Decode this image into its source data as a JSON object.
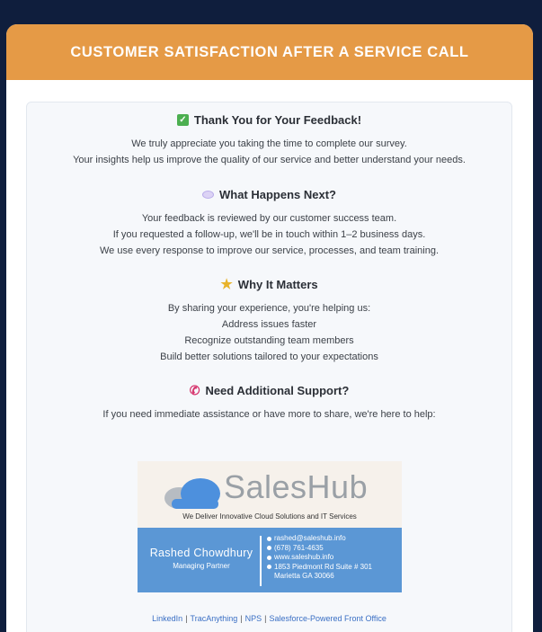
{
  "header": {
    "title": "CUSTOMER SATISFACTION AFTER A SERVICE CALL"
  },
  "sections": [
    {
      "icon": "check-icon",
      "title": "Thank You for Your Feedback!",
      "lines": [
        "We truly appreciate you taking the time to complete our survey.",
        "Your insights help us improve the quality of our service and better understand your needs."
      ]
    },
    {
      "icon": "speech-bubble-icon",
      "title": "What Happens Next?",
      "lines": [
        "Your feedback is reviewed by our customer success team.",
        "If you requested a follow-up, we'll be in touch within 1–2 business days.",
        "We use every response to improve our service, processes, and team training."
      ]
    },
    {
      "icon": "star-icon",
      "title": "Why It Matters",
      "lines": [
        "By sharing your experience, you're helping us:",
        "Address issues faster",
        "Recognize outstanding team members",
        "Build better solutions tailored to your expectations"
      ]
    },
    {
      "icon": "phone-icon",
      "title": "Need Additional Support?",
      "lines": [
        "If you need immediate assistance or have more to share, we're here to help:"
      ]
    }
  ],
  "signature": {
    "brand": "SalesHub",
    "tagline": "We Deliver Innovative Cloud Solutions and IT Services",
    "name": "Rashed Chowdhury",
    "role": "Managing Partner",
    "email": "rashed@saleshub.info",
    "phone": "(678) 761-4635",
    "website": "www.saleshub.info",
    "address_line1": "1853 Piedmont Rd Suite # 301",
    "address_line2": "Marietta GA 30066"
  },
  "footer_links": [
    "LinkedIn",
    "TracAnything",
    "NPS",
    "Salesforce-Powered Front Office"
  ],
  "colors": {
    "header": "#e59a46",
    "signature_blue": "#5b97d5",
    "background": "#0f1e3d"
  }
}
